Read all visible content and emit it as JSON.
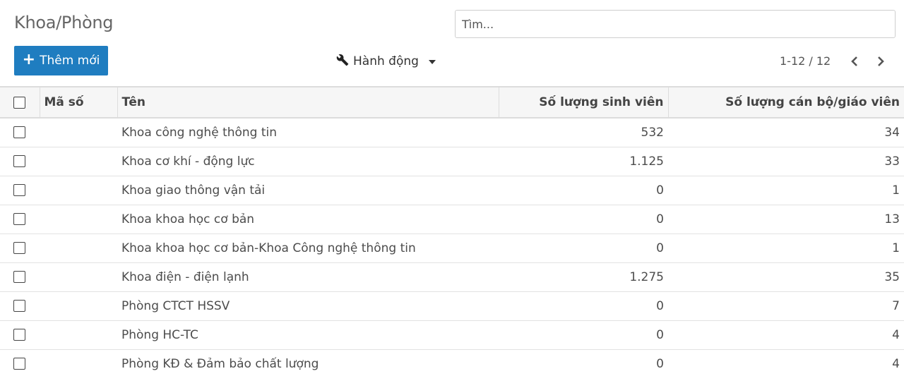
{
  "page": {
    "title": "Khoa/Phòng"
  },
  "search": {
    "placeholder": "Tìm..."
  },
  "toolbar": {
    "new_label": "Thêm mới",
    "action_label": "Hành động",
    "pager_text": "1-12 / 12"
  },
  "icons": {
    "plus": "plus-icon",
    "wrench": "wrench-icon",
    "prev": "chevron-left-icon",
    "next": "chevron-right-icon"
  },
  "table": {
    "headers": {
      "code": "Mã số",
      "name": "Tên",
      "students": "Số lượng sinh viên",
      "staff": "Số lượng cán bộ/giáo viên"
    },
    "rows": [
      {
        "code": "",
        "name": "Khoa công nghệ thông tin",
        "students": "532",
        "staff": "34"
      },
      {
        "code": "",
        "name": "Khoa cơ khí - động lực",
        "students": "1.125",
        "staff": "33"
      },
      {
        "code": "",
        "name": "Khoa giao thông vận tải",
        "students": "0",
        "staff": "1"
      },
      {
        "code": "",
        "name": "Khoa khoa học cơ bản",
        "students": "0",
        "staff": "13"
      },
      {
        "code": "",
        "name": "Khoa khoa học cơ bản-Khoa Công nghệ thông tin",
        "students": "0",
        "staff": "1"
      },
      {
        "code": "",
        "name": "Khoa điện - điện lạnh",
        "students": "1.275",
        "staff": "35"
      },
      {
        "code": "",
        "name": "Phòng CTCT HSSV",
        "students": "0",
        "staff": "7"
      },
      {
        "code": "",
        "name": "Phòng HC-TC",
        "students": "0",
        "staff": "4"
      },
      {
        "code": "",
        "name": "Phòng KĐ & Đảm bảo chất lượng",
        "students": "0",
        "staff": "4"
      }
    ]
  },
  "colors": {
    "primary": "#1f7dc0",
    "header_bg": "#f6f6f6"
  }
}
